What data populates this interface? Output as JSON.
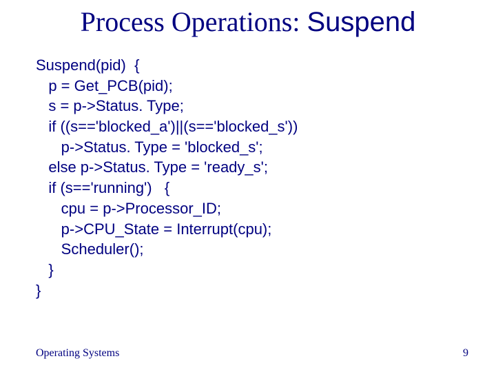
{
  "title": {
    "part1": "Process Operations: ",
    "part2": "Suspend"
  },
  "code_lines": {
    "l0": "Suspend(pid)  {",
    "l1": "   p = Get_PCB(pid);",
    "l2": "   s = p->Status. Type;",
    "l3": "   if ((s=='blocked_a')||(s=='blocked_s'))",
    "l4": "      p->Status. Type = 'blocked_s';",
    "l5": "   else p->Status. Type = 'ready_s';",
    "l6": "   if (s=='running')   {",
    "l7": "      cpu = p->Processor_ID;",
    "l8": "      p->CPU_State = Interrupt(cpu);",
    "l9": "      Scheduler();",
    "l10": "   }",
    "l11": "}"
  },
  "footer": {
    "left": "Operating Systems",
    "right": "9"
  }
}
